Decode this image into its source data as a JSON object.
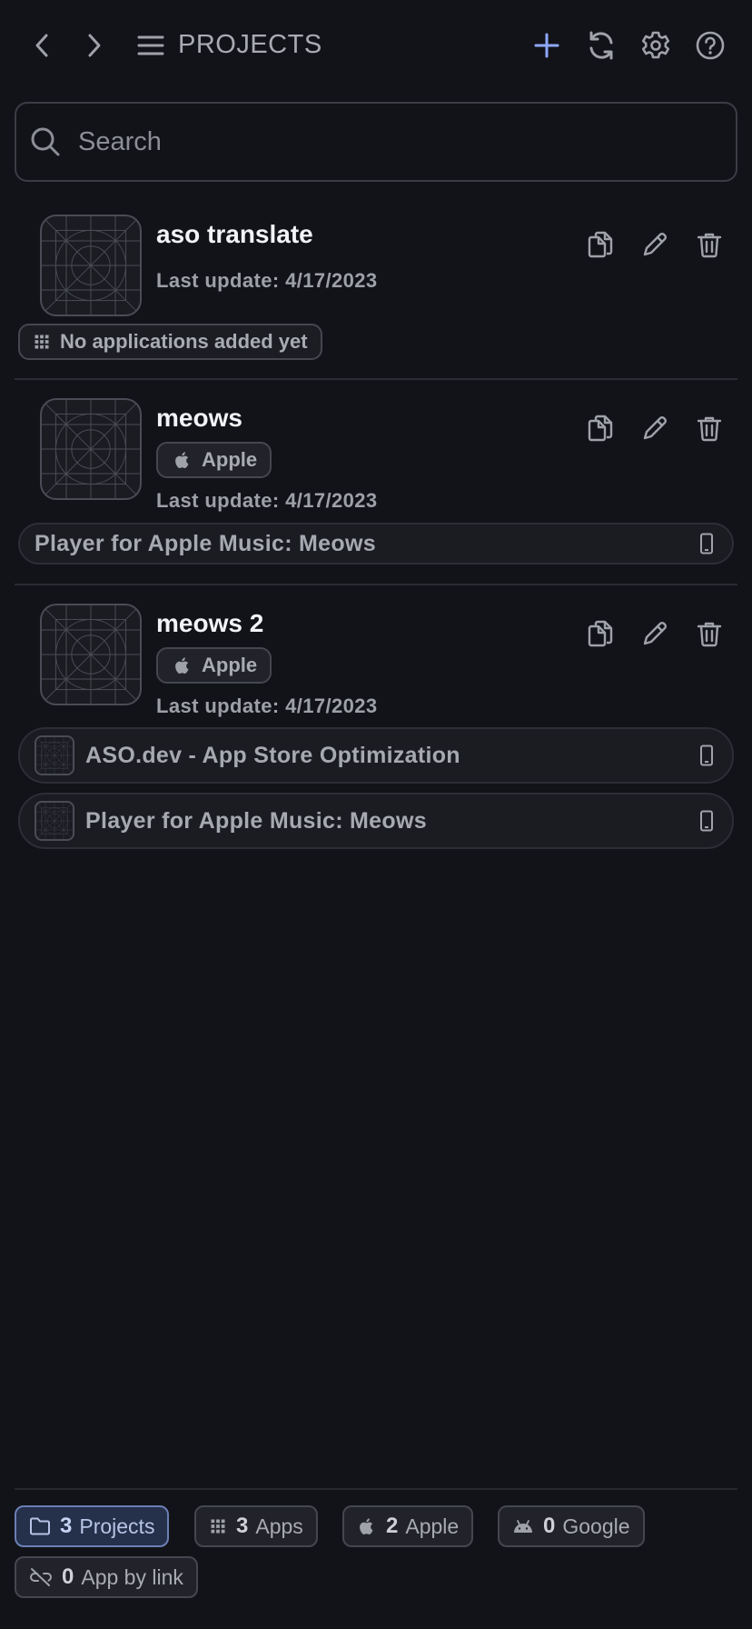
{
  "header": {
    "title": "PROJECTS",
    "icons": [
      "chevron-left-icon",
      "chevron-right-icon",
      "menu-icon",
      "plus-icon",
      "sync-icon",
      "gear-icon",
      "help-icon"
    ]
  },
  "search": {
    "placeholder": "Search",
    "value": ""
  },
  "projects": [
    {
      "name": "aso translate",
      "last_update": "Last update: 4/17/2023",
      "store": "",
      "apps_empty": "No applications added yet",
      "apps": []
    },
    {
      "name": "meows",
      "last_update": "Last update: 4/17/2023",
      "store": "Apple",
      "apps": [
        {
          "name": "Player for Apple Music: Meows"
        }
      ]
    },
    {
      "name": "meows 2",
      "last_update": "Last update: 4/17/2023",
      "store": "Apple",
      "apps": [
        {
          "name": "ASO.dev - App Store Optimization"
        },
        {
          "name": "Player for Apple Music: Meows"
        }
      ]
    }
  ],
  "footer": {
    "stats": [
      {
        "count": "3",
        "label": "Projects",
        "icon": "folder-icon",
        "active": true
      },
      {
        "count": "3",
        "label": "Apps",
        "icon": "grid-icon",
        "active": false
      },
      {
        "count": "2",
        "label": "Apple",
        "icon": "apple-icon",
        "active": false
      },
      {
        "count": "0",
        "label": "Google",
        "icon": "android-icon",
        "active": false
      },
      {
        "count": "0",
        "label": "App by link",
        "icon": "link-off-icon",
        "active": false
      }
    ]
  },
  "colors": {
    "background": "#121318",
    "accent": "#8fa8ff",
    "text": "#f2f3f6",
    "muted": "#9ea0a8"
  }
}
